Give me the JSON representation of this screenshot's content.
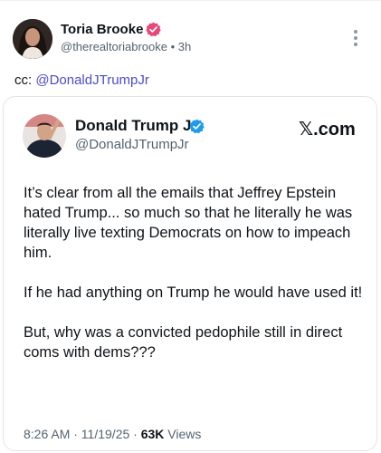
{
  "post": {
    "author_name": "Toria Brooke",
    "handle": "@therealtoriabrooke",
    "separator": " • ",
    "time": "3h",
    "cc_label": "cc: ",
    "cc_mention": "@DonaldJTrumpJr",
    "colors": {
      "verified_badge": "#e8477a",
      "mention": "#4a4ccf"
    }
  },
  "quoted": {
    "author_name": "Donald Trump Jr.",
    "handle": "@DonaldJTrumpJr",
    "source": "𝕏.com",
    "paragraphs": [
      "It’s clear from all the emails that Jeffrey Epstein hated Trump... so much so that he literally he was literally live texting Democrats on how to impeach him.",
      "If he had anything on Trump he would have used it!",
      "But, why was a convicted pedophile still in direct coms with dems???"
    ],
    "timestamp": "8:26 AM · 11/19/25 · ",
    "views_count": "63K",
    "views_label": " Views",
    "colors": {
      "verified_badge": "#1d9bf0"
    }
  },
  "icons": {
    "more": "more-vertical-icon",
    "verified_pink": "verified-badge-icon",
    "verified_blue": "verified-badge-icon"
  }
}
